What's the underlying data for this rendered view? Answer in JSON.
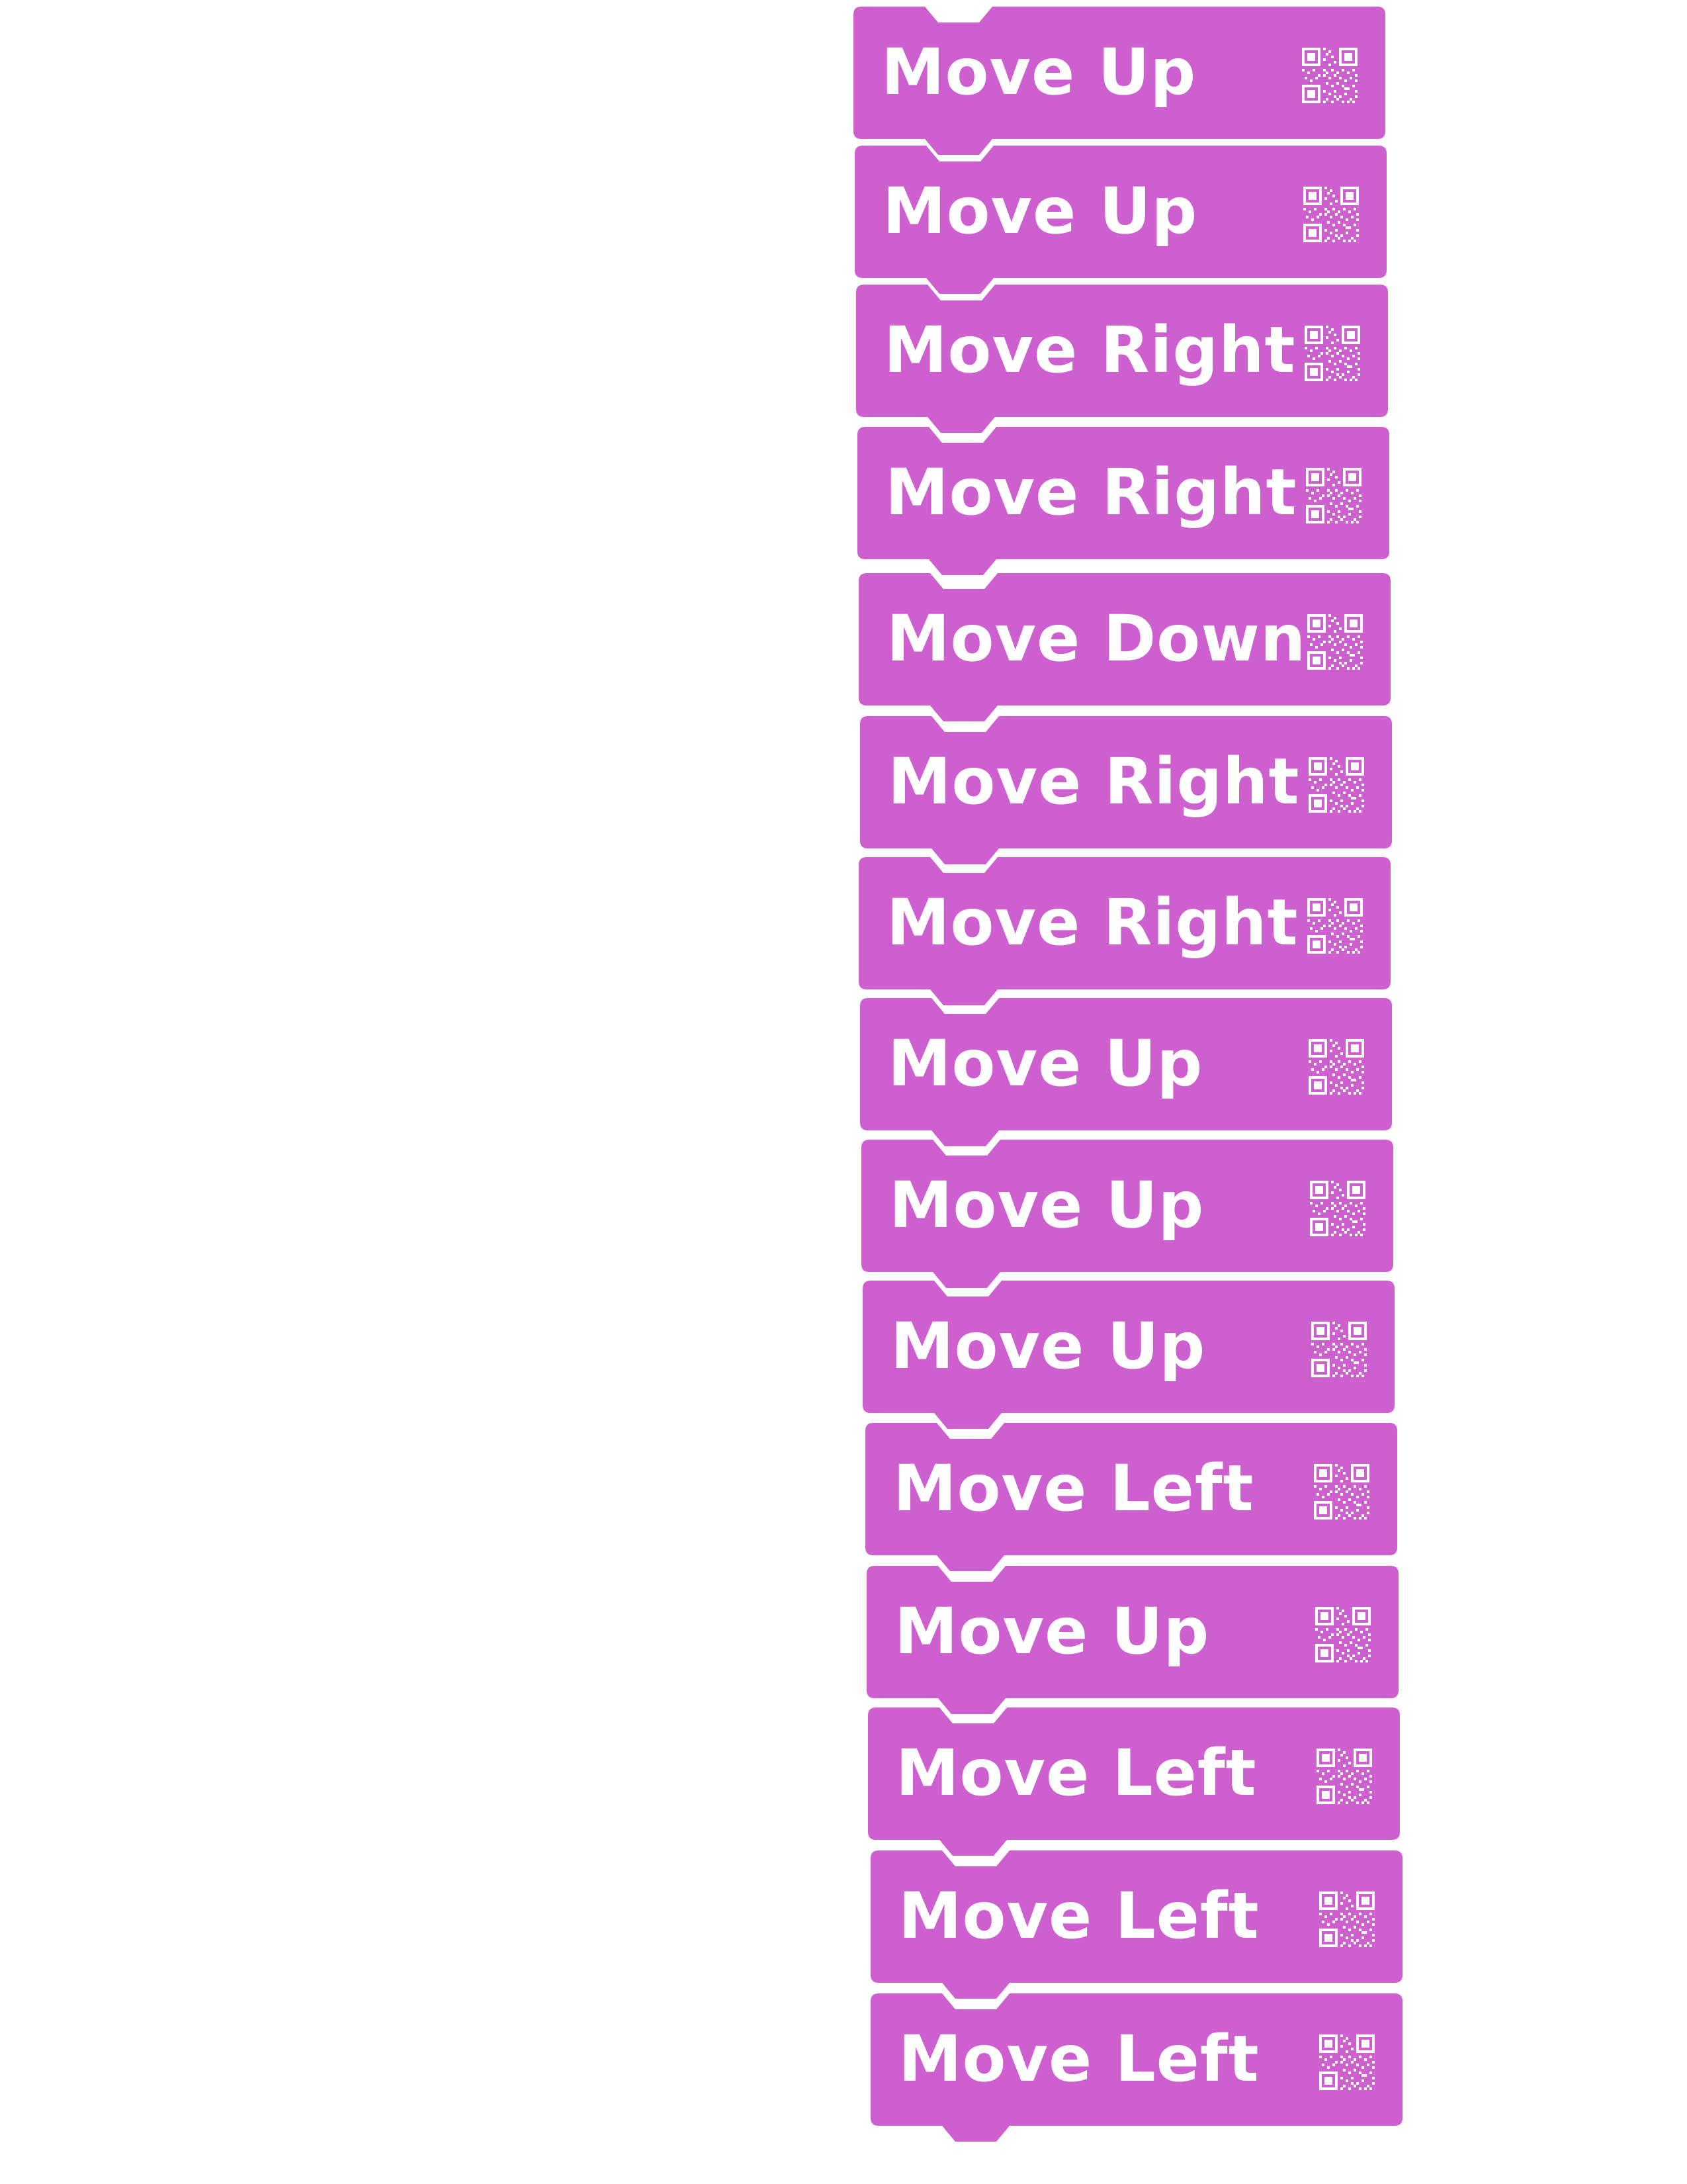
{
  "colors": {
    "block_fill": "#cd5fcf",
    "block_text": "#ffffff",
    "background": "#ffffff"
  },
  "blocks": [
    {
      "label": "Move Up",
      "icon": "qr-code-icon"
    },
    {
      "label": "Move Up",
      "icon": "qr-code-icon"
    },
    {
      "label": "Move Right",
      "icon": "qr-code-icon"
    },
    {
      "label": "Move Right",
      "icon": "qr-code-icon"
    },
    {
      "label": "Move Down",
      "icon": "qr-code-icon"
    },
    {
      "label": "Move Right",
      "icon": "qr-code-icon"
    },
    {
      "label": "Move Right",
      "icon": "qr-code-icon"
    },
    {
      "label": "Move Up",
      "icon": "qr-code-icon"
    },
    {
      "label": "Move Up",
      "icon": "qr-code-icon"
    },
    {
      "label": "Move Up",
      "icon": "qr-code-icon"
    },
    {
      "label": "Move Left",
      "icon": "qr-code-icon"
    },
    {
      "label": "Move Up",
      "icon": "qr-code-icon"
    },
    {
      "label": "Move Left",
      "icon": "qr-code-icon"
    },
    {
      "label": "Move Left",
      "icon": "qr-code-icon"
    },
    {
      "label": "Move Left",
      "icon": "qr-code-icon"
    }
  ]
}
